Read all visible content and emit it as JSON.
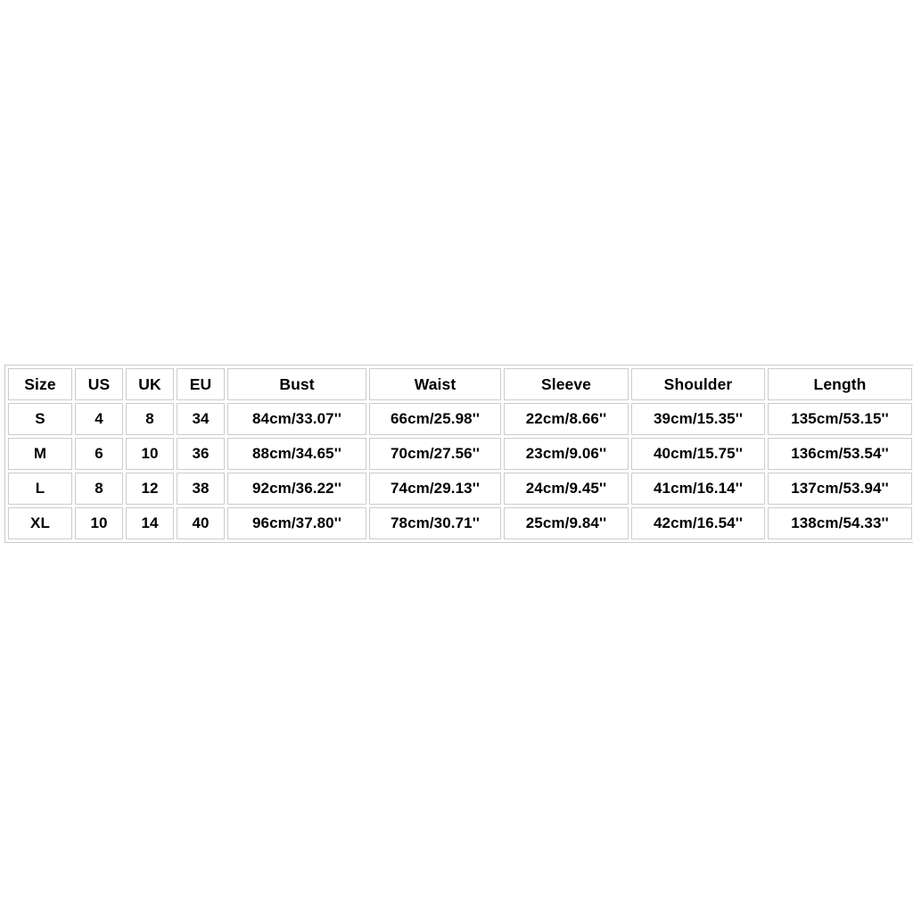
{
  "table": {
    "columns": [
      {
        "key": "size",
        "label": "Size",
        "class": "c-size"
      },
      {
        "key": "us",
        "label": "US",
        "class": "c-us"
      },
      {
        "key": "uk",
        "label": "UK",
        "class": "c-uk"
      },
      {
        "key": "eu",
        "label": "EU",
        "class": "c-eu"
      },
      {
        "key": "bust",
        "label": "Bust",
        "class": "c-bust"
      },
      {
        "key": "waist",
        "label": "Waist",
        "class": "c-waist"
      },
      {
        "key": "sleeve",
        "label": "Sleeve",
        "class": "c-sleeve"
      },
      {
        "key": "shoulder",
        "label": "Shoulder",
        "class": "c-shoulder"
      },
      {
        "key": "length",
        "label": "Length",
        "class": "c-length"
      }
    ],
    "rows": [
      {
        "size": "S",
        "us": "4",
        "uk": "8",
        "eu": "34",
        "bust": "84cm/33.07''",
        "waist": "66cm/25.98''",
        "sleeve": "22cm/8.66''",
        "shoulder": "39cm/15.35''",
        "length": "135cm/53.15''"
      },
      {
        "size": "M",
        "us": "6",
        "uk": "10",
        "eu": "36",
        "bust": "88cm/34.65''",
        "waist": "70cm/27.56''",
        "sleeve": "23cm/9.06''",
        "shoulder": "40cm/15.75''",
        "length": "136cm/53.54''"
      },
      {
        "size": "L",
        "us": "8",
        "uk": "12",
        "eu": "38",
        "bust": "92cm/36.22''",
        "waist": "74cm/29.13''",
        "sleeve": "24cm/9.45''",
        "shoulder": "41cm/16.14''",
        "length": "137cm/53.94''"
      },
      {
        "size": "XL",
        "us": "10",
        "uk": "14",
        "eu": "40",
        "bust": "96cm/37.80''",
        "waist": "78cm/30.71''",
        "sleeve": "25cm/9.84''",
        "shoulder": "42cm/16.54''",
        "length": "138cm/54.33''"
      }
    ]
  },
  "colors": {
    "page_background": "#ffffff",
    "cell_background": "#ffffff",
    "cell_border": "#cccccc",
    "table_border": "#c9c9c9",
    "text": "#000000"
  }
}
